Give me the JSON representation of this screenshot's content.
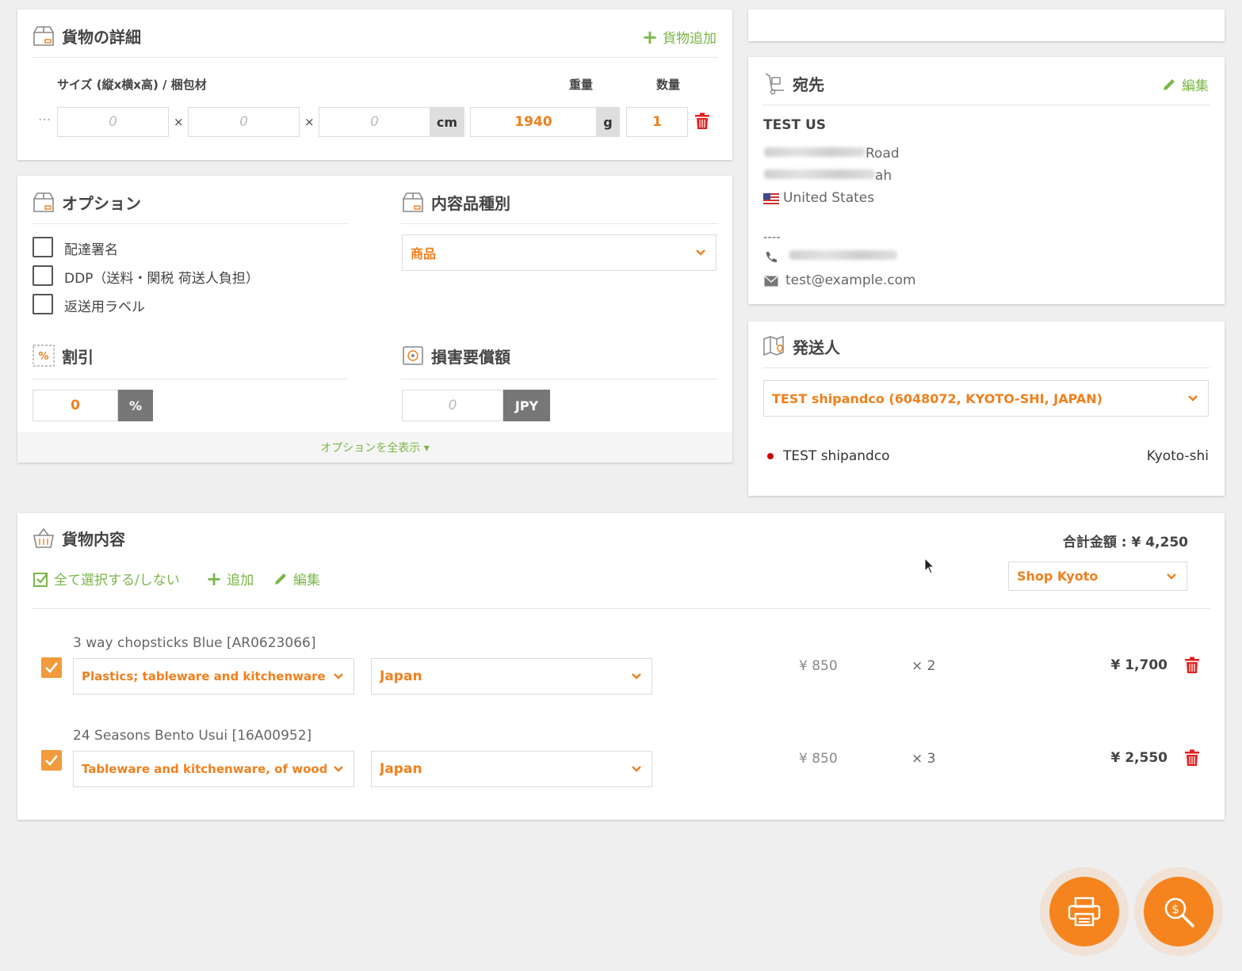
{
  "cargo_details": {
    "title": "貨物の詳細",
    "add_label": "貨物追加",
    "size_header": "サイズ (縦x横x高) / 梱包材",
    "weight_header": "重量",
    "qty_header": "数量",
    "dots": "···",
    "length_placeholder": "0",
    "width_placeholder": "0",
    "height_placeholder": "0",
    "times": "×",
    "size_unit": "cm",
    "weight_value": "1940",
    "weight_unit": "g",
    "qty_value": "1"
  },
  "options": {
    "title": "オプション",
    "items": [
      {
        "label": "配達署名",
        "checked": false
      },
      {
        "label": "DDP（送料・関税 荷送人負担）",
        "checked": false
      },
      {
        "label": "返送用ラベル",
        "checked": false
      }
    ],
    "discount_title": "割引",
    "discount_value": "0",
    "discount_unit": "%",
    "show_all_label": "オプションを全表示 ▾"
  },
  "content_type": {
    "title": "内容品種別",
    "selected": "商品"
  },
  "insurance": {
    "title": "損害要償額",
    "placeholder": "0",
    "unit": "JPY"
  },
  "destination": {
    "title": "宛先",
    "edit_label": "編集",
    "name": "TEST US",
    "address_line1_tail": "Road",
    "address_line2_tail": "ah",
    "country": "United States",
    "dashes": "----",
    "email": "test@example.com"
  },
  "sender": {
    "title": "発送人",
    "selected": "TEST shipandco (6048072, KYOTO-SHI, JAPAN)",
    "name": "TEST shipandco",
    "city": "Kyoto-shi"
  },
  "contents": {
    "title": "貨物内容",
    "total_label": "合計金額 : ¥ 4,250",
    "select_all_label": "全て選択する/しない",
    "add_label": "追加",
    "edit_label": "編集",
    "shop": "Shop Kyoto",
    "items": [
      {
        "name": "3 way chopsticks Blue [AR0623066]",
        "category": "Plastics; tableware and kitchenware",
        "origin": "Japan",
        "unit_price": "¥ 850",
        "qty": "× 2",
        "total": "¥ 1,700",
        "checked": true
      },
      {
        "name": "24 Seasons Bento Usui [16A00952]",
        "category": "Tableware and kitchenware, of wood; n",
        "origin": "Japan",
        "unit_price": "¥ 850",
        "qty": "× 3",
        "total": "¥ 2,550",
        "checked": true
      }
    ]
  },
  "colors": {
    "accent_orange": "#f0801e",
    "accent_green": "#7ab648",
    "danger_red": "#e02020"
  }
}
